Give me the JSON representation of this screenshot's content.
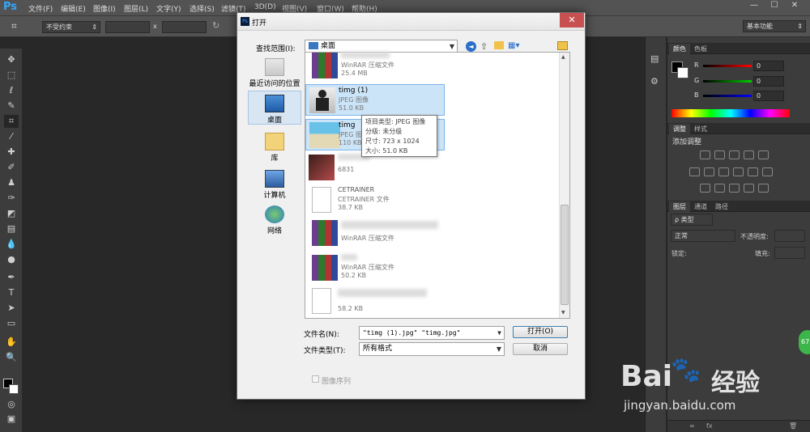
{
  "app": {
    "logo": "Ps"
  },
  "menu": [
    "文件(F)",
    "编辑(E)",
    "图像(I)",
    "图层(L)",
    "文字(Y)",
    "选择(S)",
    "滤镜(T)",
    "3D(D)",
    "视图(V)",
    "窗口(W)",
    "帮助(H)"
  ],
  "window_controls": {
    "minimize": "—",
    "maximize": "☐",
    "close": "✕"
  },
  "options_bar": {
    "ratio_select": "不受约束",
    "x_sep": "x",
    "workspace": "基本功能"
  },
  "panels": {
    "color_tabs": [
      "颜色",
      "色板"
    ],
    "color_channels": [
      {
        "label": "R",
        "value": "0"
      },
      {
        "label": "G",
        "value": "0"
      },
      {
        "label": "B",
        "value": "0"
      }
    ],
    "adjust_tabs": [
      "调整",
      "样式"
    ],
    "adjust_title": "添加调整",
    "layers_tabs": [
      "图层",
      "通道",
      "路径"
    ],
    "layer_filter": "ρ 类型",
    "blend_mode": "正常",
    "opacity_label": "不透明度:",
    "lock_label": "锁定:",
    "fill_label": "填充:"
  },
  "dialog": {
    "title": "打开",
    "look_in_label": "查找范围(I):",
    "look_in_value": "桌面",
    "places": [
      {
        "label": "最近访问的位置",
        "icon": "recent-places-icon"
      },
      {
        "label": "桌面",
        "icon": "desktop-icon"
      },
      {
        "label": "库",
        "icon": "libraries-icon"
      },
      {
        "label": "计算机",
        "icon": "computer-icon"
      },
      {
        "label": "网络",
        "icon": "network-icon"
      }
    ],
    "files": [
      {
        "name": "",
        "type": "WinRAR 压缩文件",
        "size": "25.4 MB",
        "kind": "rar"
      },
      {
        "name": "timg (1)",
        "type": "JPEG 图像",
        "size": "51.0 KB",
        "kind": "photo-person",
        "selected": true
      },
      {
        "name": "timg",
        "type": "JPEG 图像",
        "size": "110 KB",
        "kind": "photo-beach",
        "selected": true
      },
      {
        "name": "",
        "type": "",
        "size": "6831",
        "kind": "blurred"
      },
      {
        "name": "CETRAINER",
        "type": "CETRAINER 文件",
        "size": "38.7 KB",
        "kind": "doc"
      },
      {
        "name": "",
        "type": "WinRAR 压缩文件",
        "size": "",
        "kind": "rar"
      },
      {
        "name": "",
        "type": "WinRAR 压缩文件",
        "size": "50.2 KB",
        "kind": "rar"
      },
      {
        "name": "",
        "type": "",
        "size": "58.2 KB",
        "kind": "doc"
      }
    ],
    "tooltip": [
      "项目类型: JPEG 图像",
      "分级: 未分级",
      "尺寸: 723 x 1024",
      "大小: 51.0 KB"
    ],
    "filename_label": "文件名(N):",
    "filename_value": "\"timg (1).jpg\" \"timg.jpg\"",
    "filetype_label": "文件类型(T):",
    "filetype_value": "所有格式",
    "open_button": "打开(O)",
    "cancel_button": "取消",
    "sequence_label": "图像序列"
  },
  "watermark": {
    "brand": "Bai",
    "brand2": "经验",
    "url": "jingyan.baidu.com",
    "badge": "67"
  }
}
